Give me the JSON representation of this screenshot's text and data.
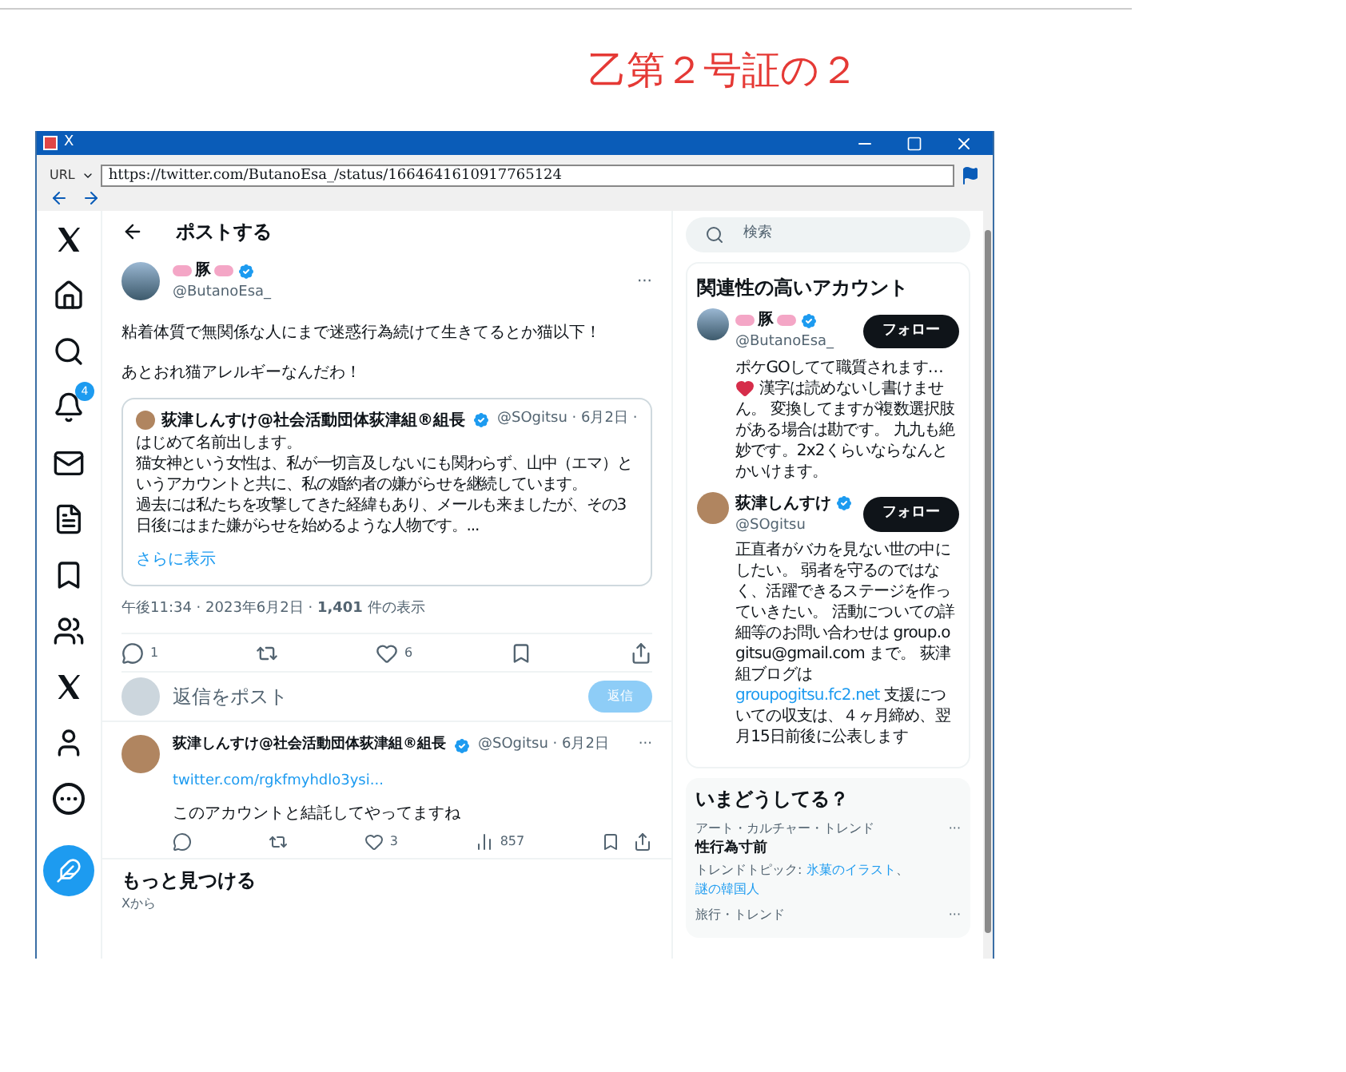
{
  "doc_label": "乙第２号証の２",
  "window": {
    "title": "X"
  },
  "address_bar": {
    "label": "URL",
    "value": "https://twitter.com/ButanoEsa_/status/1664641610917765124"
  },
  "nav": [
    {
      "kind": "x"
    },
    {
      "kind": "home"
    },
    {
      "kind": "search"
    },
    {
      "kind": "bell",
      "badge": "4"
    },
    {
      "kind": "mail"
    },
    {
      "kind": "list"
    },
    {
      "kind": "bookmark"
    },
    {
      "kind": "communities"
    },
    {
      "kind": "x"
    },
    {
      "kind": "profile"
    },
    {
      "kind": "more"
    }
  ],
  "header": {
    "title": "ポストする"
  },
  "post": {
    "name": "豚",
    "handle": "@ButanoEsa_",
    "verified": true,
    "more": "···",
    "paragraphs": [
      "粘着体質で無関係な人にまで迷惑行為続けて生きてるとか猫以下！",
      "あとおれ猫アレルギーなんだわ！"
    ],
    "quote": {
      "name": "荻津しんすけ@社会活動団体荻津組®組長",
      "handle": "@SOgitsu · 6月2日 ·",
      "lines": [
        "はじめて名前出します。",
        "猫女神という女性は、私が一切言及しないにも関わらず、山中（エマ）というアカウントと共に、私の婚約者の嫌がらせを継続しています。",
        "過去には私たちを攻撃してきた経緯もあり、メールも来ましたが、その3日後にはまた嫌がらせを始めるような人物です。..."
      ],
      "show_more": "さらに表示"
    },
    "meta": "午後11:34 · 2023年6月2日 · **1,401** 件の表示",
    "actions": {
      "replies": "1",
      "likes": "6"
    }
  },
  "reply_box": {
    "placeholder": "返信をポスト",
    "button": "返信",
    "disabled": true
  },
  "reply": {
    "name": "荻津しんすけ@社会活動団体荻津組®組長",
    "verified": true,
    "handle": "@SOgitsu · 6月2日",
    "more": "···",
    "link": "twitter.com/rgkfmyhdlo3ysi...",
    "text": "このアカウントと結託してやってますね",
    "actions": {
      "likes": "3",
      "views": "857"
    }
  },
  "discover": {
    "title": "もっと見つける",
    "subtitle": "Xから"
  },
  "search": {
    "placeholder": "検索"
  },
  "relevant": {
    "title": "関連性の高いアカウント",
    "accounts": [
      {
        "name": "豚",
        "pig_marks": true,
        "verified": true,
        "handle": "@ButanoEsa_",
        "follow": "フォロー",
        "bio": [
          {
            "kind": "text",
            "text": "ポケGOしてて職質されます…"
          },
          {
            "kind": "emoji"
          },
          {
            "kind": "text",
            "text": " 漢字は読めないし書けません。 変換してますが複数選択肢がある場合は勘です。 九九も絶妙です。2x2くらいならなんとかいけます。"
          }
        ]
      },
      {
        "name": "荻津しんすけ",
        "pig_marks": false,
        "verified": true,
        "handle": "@SOgitsu",
        "follow": "フォロー",
        "bio": [
          {
            "kind": "text",
            "text": "正直者がバカを見ない世の中にしたい。 弱者を守るのではなく、活躍できるステージを作っていきたい。 活動についての詳細等のお問い合わせは group.ogitsu@gmail.com まで。 荻津組ブログは "
          },
          {
            "kind": "link",
            "text": "groupogitsu.fc2.net"
          },
          {
            "kind": "text",
            "text": " 支援についての収支は、４ヶ月締め、翌月15日前後に公表します"
          }
        ]
      }
    ]
  },
  "trends": {
    "title": "いまどうしてる？",
    "items": [
      {
        "category": "アート・カルチャー・トレンド",
        "topic": "性行為寸前",
        "more": "···",
        "related_label": "トレンドトピック: ",
        "related_separator": "、",
        "related": [
          "氷菓のイラスト",
          "謎の韓国人"
        ]
      },
      {
        "category": "旅行・トレンド",
        "more": "···"
      }
    ]
  }
}
